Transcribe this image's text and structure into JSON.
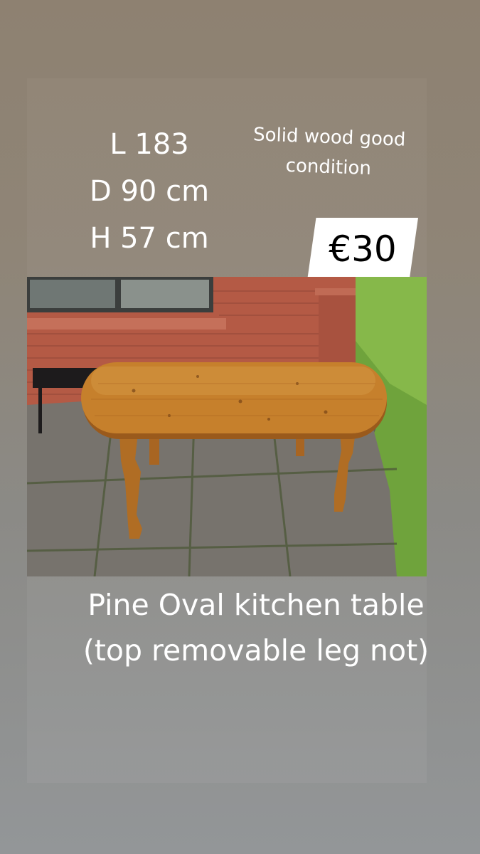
{
  "dimensions": {
    "length": "L 183",
    "depth": "D 90 cm",
    "height": "H 57 cm"
  },
  "note": "Solid wood good condition",
  "price": "€30",
  "caption": "Pine Oval kitchen table (top removable leg not)",
  "photo": {
    "subject": "oval pine kitchen table on paved patio by brick wall"
  },
  "colors": {
    "background": "#8f8577",
    "text": "#ffffff",
    "price_tag": "#ffffff",
    "price_text": "#000000",
    "pine_wood": "#c6802c",
    "brick": "#b45a45",
    "grass": "#6fa33c"
  }
}
